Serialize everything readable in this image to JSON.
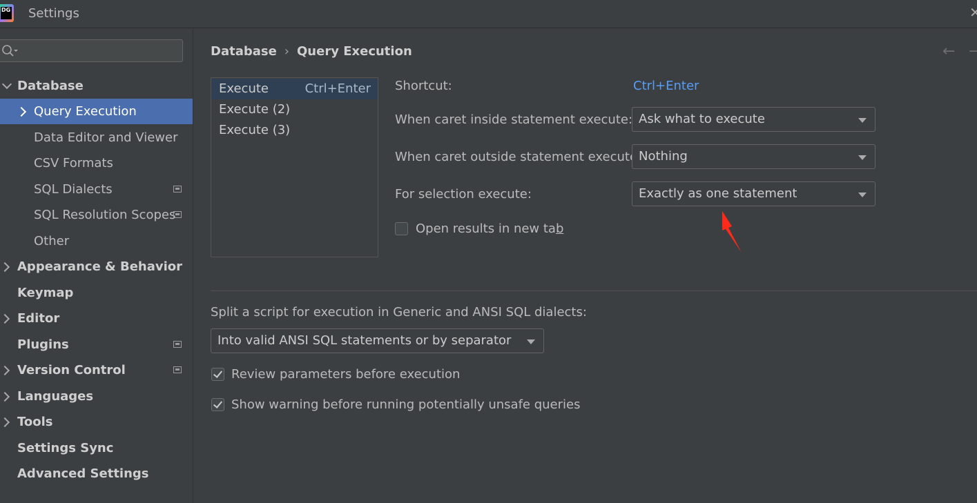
{
  "window": {
    "title": "Settings",
    "logo_text": "DG"
  },
  "search": {
    "placeholder": ""
  },
  "sidebar": {
    "items": [
      {
        "label": "Database"
      },
      {
        "label": "Query Execution"
      },
      {
        "label": "Data Editor and Viewer"
      },
      {
        "label": "CSV Formats"
      },
      {
        "label": "SQL Dialects"
      },
      {
        "label": "SQL Resolution Scopes"
      },
      {
        "label": "Other"
      },
      {
        "label": "Appearance & Behavior"
      },
      {
        "label": "Keymap"
      },
      {
        "label": "Editor"
      },
      {
        "label": "Plugins"
      },
      {
        "label": "Version Control"
      },
      {
        "label": "Languages"
      },
      {
        "label": "Tools"
      },
      {
        "label": "Settings Sync"
      },
      {
        "label": "Advanced Settings"
      }
    ]
  },
  "breadcrumb": {
    "parent": "Database",
    "separator": "›",
    "current": "Query Execution"
  },
  "executes": [
    {
      "name": "Execute",
      "shortcut": "Ctrl+Enter"
    },
    {
      "name": "Execute (2)",
      "shortcut": ""
    },
    {
      "name": "Execute (3)",
      "shortcut": ""
    }
  ],
  "form": {
    "shortcut_label": "Shortcut:",
    "shortcut_value": "Ctrl+Enter",
    "inside_label": "When caret inside statement execute:",
    "inside_value": "Ask what to execute",
    "outside_label": "When caret outside statement execute:",
    "outside_value": "Nothing",
    "selection_label": "For selection execute:",
    "selection_value": "Exactly as one statement",
    "open_results_label_pre": "Open results in new ta",
    "open_results_label_mnemonic": "b",
    "open_results_checked": false
  },
  "script": {
    "label": "Split a script for execution in Generic and ANSI SQL dialects:",
    "value": "Into valid ANSI SQL statements or by separator",
    "review_label": "Review parameters before execution",
    "review_checked": true,
    "warning_label": "Show warning before running potentially unsafe queries",
    "warning_checked": true
  },
  "colors": {
    "accent": "#4b6eaf",
    "link": "#589df6",
    "annotation": "#ff2a1a",
    "background": "#3c3f41"
  }
}
